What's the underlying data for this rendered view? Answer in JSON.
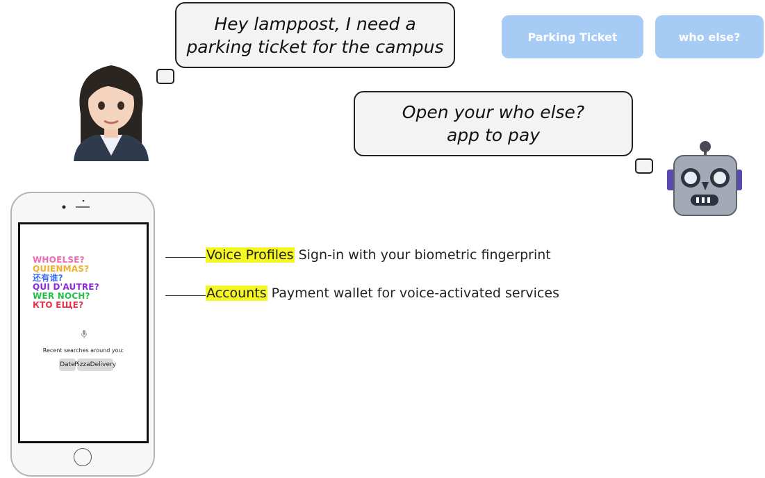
{
  "user_bubble": {
    "text": "Hey lamppost, I need a\nparking ticket for the campus"
  },
  "robot_bubble": {
    "text": "Open your who else?\napp to pay"
  },
  "buttons": {
    "parking": "Parking Ticket",
    "whoelse": "who else?"
  },
  "annotations": [
    {
      "highlight": "Voice Profiles",
      "text": "Sign-in with your biometric fingerprint"
    },
    {
      "highlight": "Accounts",
      "text": "Payment wallet for voice-activated services"
    }
  ],
  "phone": {
    "logo_lines": [
      "WHOELSE?",
      "QUIENMAS?",
      "还有谁?",
      "QUI D'AUTRE?",
      "WER NOCH?",
      "КТО ЕЩЕ?"
    ],
    "recent_label": "Recent searches around you:",
    "chips": [
      "Date",
      "PizzaDelivery"
    ]
  },
  "colors": {
    "pill": "#a6ccf6",
    "highlight": "#f4f722"
  },
  "icons": {
    "user": "woman-avatar-icon",
    "robot": "robot-icon",
    "mic": "microphone-icon"
  }
}
